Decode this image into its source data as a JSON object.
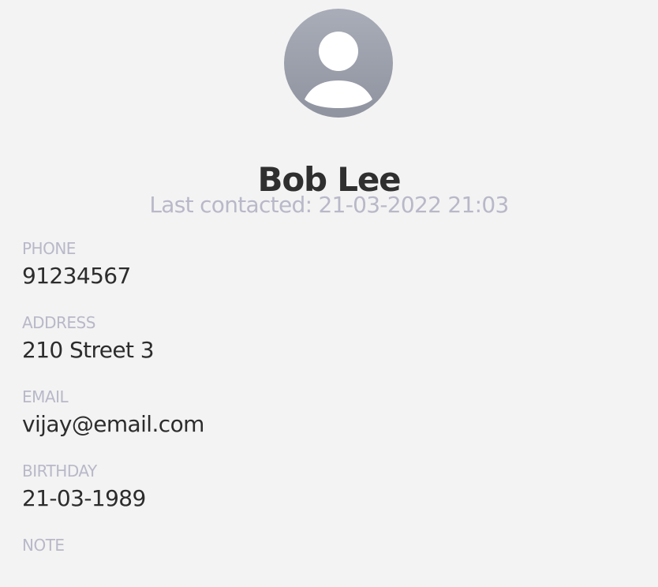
{
  "contact": {
    "name": "Bob Lee",
    "last_contacted": "Last contacted: 21-03-2022 21:03",
    "avatar_icon": "user-silhouette-icon"
  },
  "fields": {
    "phone": {
      "label": "PHONE",
      "value": "91234567"
    },
    "address": {
      "label": "ADDRESS",
      "value": "210 Street 3"
    },
    "email": {
      "label": "EMAIL",
      "value": "vijay@email.com"
    },
    "birthday": {
      "label": "BIRTHDAY",
      "value": "21-03-1989"
    },
    "note": {
      "label": "NOTE",
      "value": ""
    }
  },
  "colors": {
    "background": "#f3f3f3",
    "avatar": "#9a9eaa",
    "muted_text": "#b8b8c9",
    "primary_text": "#2c2c2c"
  }
}
